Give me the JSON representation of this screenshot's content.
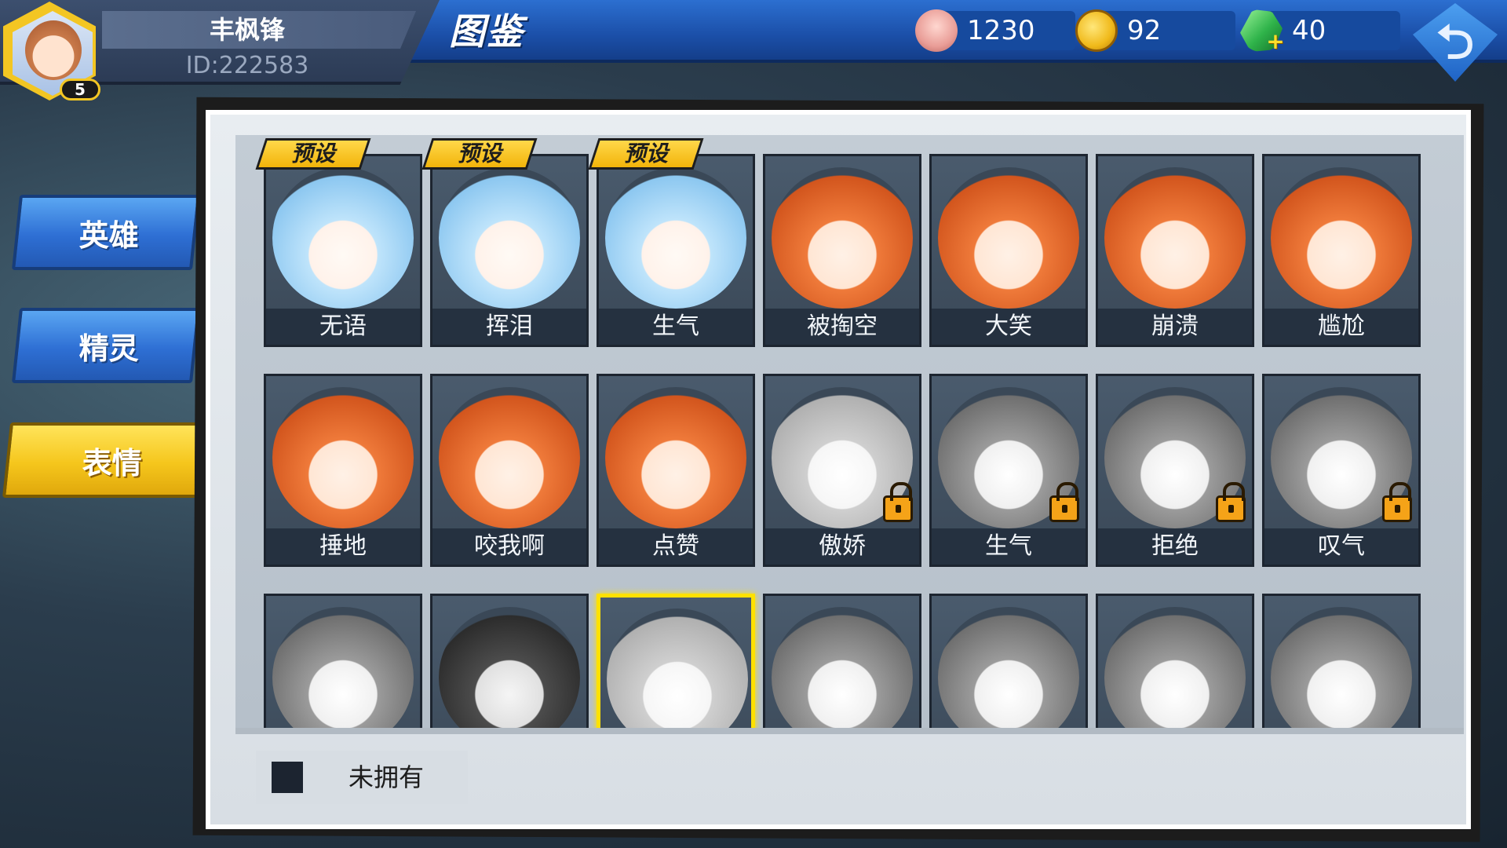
{
  "player": {
    "name": "丰枫锋",
    "id_text": "ID:222583",
    "level": "5"
  },
  "title": "图鉴",
  "currencies": [
    {
      "icon": "shell-icon",
      "value": "1230"
    },
    {
      "icon": "coin-icon",
      "value": "92"
    },
    {
      "icon": "gem-icon",
      "value": "40"
    }
  ],
  "tabs": [
    {
      "label": "英雄",
      "active": false
    },
    {
      "label": "精灵",
      "active": false
    },
    {
      "label": "表情",
      "active": true
    }
  ],
  "preset_label": "预设",
  "cards": [
    {
      "label": "无语",
      "preset": true,
      "locked": false,
      "style": "blue"
    },
    {
      "label": "挥泪",
      "preset": true,
      "locked": false,
      "style": "blue"
    },
    {
      "label": "生气",
      "preset": true,
      "locked": false,
      "style": "blue"
    },
    {
      "label": "被掏空",
      "preset": false,
      "locked": false,
      "style": "orange"
    },
    {
      "label": "大笑",
      "preset": false,
      "locked": false,
      "style": "orange"
    },
    {
      "label": "崩溃",
      "preset": false,
      "locked": false,
      "style": "orange"
    },
    {
      "label": "尴尬",
      "preset": false,
      "locked": false,
      "style": "orange"
    },
    {
      "label": "捶地",
      "preset": false,
      "locked": false,
      "style": "orange"
    },
    {
      "label": "咬我啊",
      "preset": false,
      "locked": false,
      "style": "orange"
    },
    {
      "label": "点赞",
      "preset": false,
      "locked": false,
      "style": "orange"
    },
    {
      "label": "傲娇",
      "preset": false,
      "locked": true,
      "style": "light"
    },
    {
      "label": "生气",
      "preset": false,
      "locked": true,
      "style": "gray"
    },
    {
      "label": "拒绝",
      "preset": false,
      "locked": true,
      "style": "gray"
    },
    {
      "label": "叹气",
      "preset": false,
      "locked": true,
      "style": "gray"
    },
    {
      "label": "",
      "preset": false,
      "locked": true,
      "style": "gray"
    },
    {
      "label": "",
      "preset": false,
      "locked": true,
      "style": "dark"
    },
    {
      "label": "",
      "preset": false,
      "locked": true,
      "style": "light",
      "selected": true
    },
    {
      "label": "",
      "preset": false,
      "locked": true,
      "style": "gray"
    },
    {
      "label": "",
      "preset": false,
      "locked": true,
      "style": "gray"
    },
    {
      "label": "",
      "preset": false,
      "locked": true,
      "style": "gray"
    },
    {
      "label": "",
      "preset": false,
      "locked": true,
      "style": "gray"
    }
  ],
  "legend": {
    "label": "未拥有",
    "swatch_color": "#1c2430"
  },
  "colors": {
    "topbar": "#1b4fa8",
    "active_tab": "#f5c61c",
    "tab": "#2e6fd4",
    "selected_border": "#ffe100",
    "lock": "#f5a318"
  }
}
